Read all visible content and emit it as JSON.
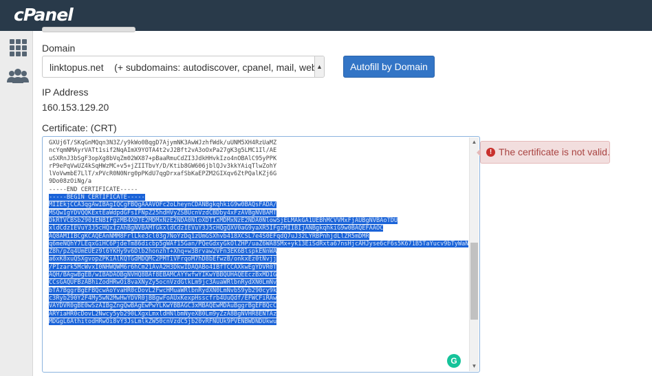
{
  "app": {
    "logo": "cPanel"
  },
  "sidebar": {
    "items": [
      {
        "icon": "grid-icon"
      },
      {
        "icon": "users-icon"
      }
    ]
  },
  "form": {
    "domain_label": "Domain",
    "domain_value": "linktopus.net    (+ subdomains: autodiscover, cpanel, mail, webdi",
    "autofill_button": "Autofill by Domain",
    "ip_label": "IP Address",
    "ip_value": "160.153.129.20",
    "cert_label": "Certificate: (CRT)",
    "cert_lines_plain": [
      "GXUj6T/SKqGnMQqn3N3Z/y9kWo0BqgD7AjymNK3AwWJzhfWdk/uUNM5XH4RzUaMZ",
      "ncYqmNMAyrVATt1sif2NqAImX9YOTA4t2vJ2Bft2vA3oOxPa27gK3g5LMC1Il/AE",
      "uSXRnJ3bSgF3opXg8bVqZm02WX87+pBaaRmuCdZI3JdkHHvkIzo4nOBAlC95yPPK",
      "rP9ePqVwUZ4kSqHWzMC+v5+jZIITbvY/D/Ktib8GW606jblQJv3kkYAiqTlwZohY",
      "lVoVwmbE7LlT/xPVcR0N0Nrg0pPKdU7qgDrxafSbKaEPZM2GIXqv6ZtPQalKZj6G",
      "9Do08zOiNg/a",
      "-----END CERTIFICATE-----"
    ],
    "cert_lines_selected": [
      "-----BEGIN CERTIFICATE-----",
      "MIIEkjCCA3qgAwIBAgIQCgFBQgAAAVOFc2oLheynCDANBgkqhkiG9w0BAQsFADA/",
      "MSQwIgYDVQQKExtEaWdpdGFsIFNpZ25hdHVyZSBUcnVzdCBDby4xFzAVBgNVBAMT",
      "DkRTVCBSb290IENBIFgzMB4XDTE2MDMxNzE2NDA0NloXDTIxMDMxNzE2NDA0NlowSjELMAkGA1UEBhMCVVMxFjAUBgNVBAoTDU",
      "xldCdzIEVuY3J5cHQxIzAhBgNVBAMTGkxldCdzIEVuY3J5cHQgQXV0aG9yaXR5IFgzMIIBIjANBgkqhkiG9w0BAQEFAAOC",
      "AQ8AMIIBCgKCAQEAnNMM8FrlLke3cl03g7NoYzDq1zUmGSXhvb418XCSL7e4S0EFqdQ7uJ32LYRBPnhjdLlZR5mDMR",
      "q6meNQhY7LEqxGiHC6PjdeTm86dicbp5gWAf15Gan/PQeGdxyGkOlZHP/uaZ6WA8SMx+yk13EiSdRxta67nsHjcAHJyse6cF6s5K671B5TaYucv9bTyWaN8jKkKQDIZ0",
      "Z8h/pZq4UmEUEz9l6YKHy9v6Dlb2honzhT+Xhq+w3Brvaw2VFn3EK6BlspkENnWA",
      "a6xK8xuQSXgvopZPKiAlKQTGdMDQMc2PMTiVFrqoM7hD8bEfwzB/onkxEz0tNvjj",
      "/PIzark5McWvxI0NHWQWM6r6hCm21AvA2H3DkwIDAQABo4IBfTCCAXkwEgYDVR0T",
      "AQH/BAgwBgEB/wIBADAOBgNVHQ8BAf8EBAMCAYYwfwYIKwYBBQUHAQEEczBxMDIG",
      "CCsGAQUFBzABhiZodHRwOi8vaXNyZy5ocnVzdGlkLm9jc3AuaWRlbnRydXN0LmNv",
      "bTA7BggrBgEFBQcwAoYvaHR0cDovL2FwcHMuaWRlbnRydXN0LmNvbS9yb290cy9k",
      "c3Ryb290Y2F4My5wN2MwHwYDVR0jBBgwFoAUxKexpHsscfrb4UuQdf/EFWCFiRAw",
      "VAYDVR0gBE0wSzAIBgZngQwBAgEwPwYLKwYBBAGC3xMBAQEwMDAuBggrBgEFBQcC",
      "ARYiaHR0cDovL2Nwcy5yb290LXgxLmxldHNlbmNyeXB0Lm9yZzA8BgNVHR8ENTAz",
      "MDGgL6AthitodHRwOi8vY3JsLmlkZW50cnVzdC5jb20vRFNUUk9PVENBWDNDUkwu"
    ]
  },
  "validation": {
    "message": "The certificate is not valid."
  },
  "colors": {
    "topbar": "#293a4a",
    "primary": "#3375c6",
    "error_bg": "#f2dede",
    "error_text": "#a94442"
  }
}
